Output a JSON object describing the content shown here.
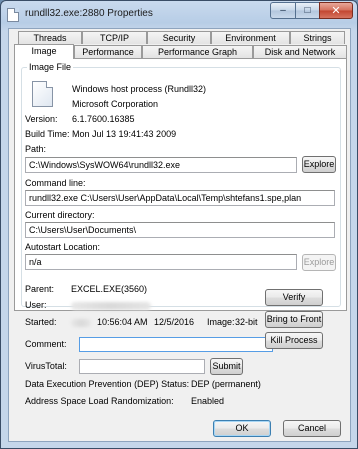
{
  "window": {
    "title": "rundll32.exe:2880 Properties"
  },
  "caption_buttons": {
    "minimize": "–",
    "maximize": "□",
    "close": "✕"
  },
  "tabs_row1": [
    "Threads",
    "TCP/IP",
    "Security",
    "Environment",
    "Strings"
  ],
  "tabs_row2": [
    "Image",
    "Performance",
    "Performance Graph",
    "Disk and Network"
  ],
  "active_tab": "Image",
  "image_file": {
    "group_label": "Image File",
    "description": "Windows host process (Rundll32)",
    "company": "Microsoft Corporation",
    "version_label": "Version:",
    "version": "6.1.7600.16385",
    "build_time_label": "Build Time:",
    "build_time": "Mon Jul 13 19:41:43 2009",
    "path_label": "Path:",
    "path": "C:\\Windows\\SysWOW64\\rundll32.exe",
    "explore_label": "Explore",
    "command_line_label": "Command line:",
    "command_line": "rundll32.exe C:\\Users\\User\\AppData\\Local\\Temp\\shtefans1.spe,plan",
    "current_directory_label": "Current directory:",
    "current_directory": "C:\\Users\\User\\Documents\\",
    "autostart_label": "Autostart Location:",
    "autostart": "n/a",
    "autostart_explore_label": "Explore"
  },
  "process": {
    "parent_label": "Parent:",
    "parent": "EXCEL.EXE(3560)",
    "user_label": "User:",
    "started_label": "Started:",
    "started_time": "10:56:04 AM",
    "started_date": "12/5/2016",
    "image_label": "Image:",
    "image_bits": "32-bit",
    "comment_label": "Comment:",
    "virustotal_label": "VirusTotal:",
    "submit_label": "Submit",
    "dep_label": "Data Execution Prevention (DEP) Status:",
    "dep_value": "DEP (permanent)",
    "aslr_label": "Address Space Load Randomization:",
    "aslr_value": "Enabled"
  },
  "side_buttons": {
    "verify": "Verify",
    "bring_to_front": "Bring to Front",
    "kill_process": "Kill Process"
  },
  "footer": {
    "ok": "OK",
    "cancel": "Cancel"
  }
}
